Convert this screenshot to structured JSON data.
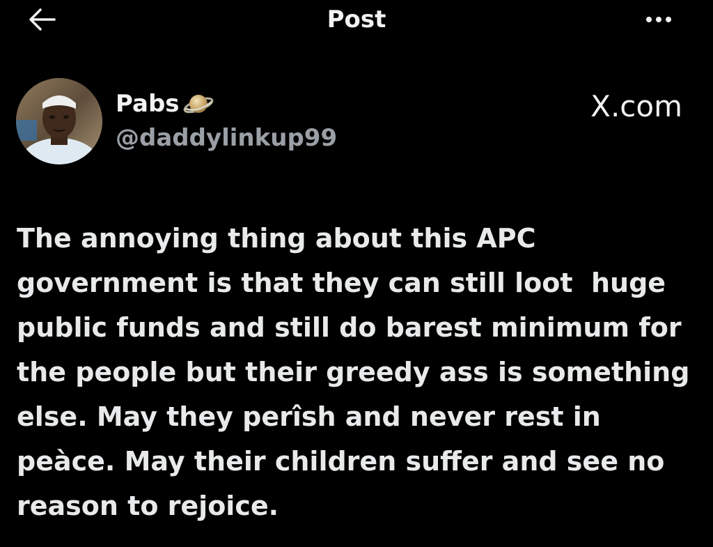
{
  "header": {
    "title": "Post",
    "back_icon": "arrow-left-icon",
    "more_icon": "more-horizontal-icon"
  },
  "post": {
    "author": {
      "display_name": "Pabs",
      "badge_icon": "saturn-planet-icon",
      "handle": "@daddylinkup99"
    },
    "watermark": "X.com",
    "text": "The annoying thing about this APC government is that they can still loot  huge public funds and still do barest minimum for the people but their greedy ass is something else. May they perîsh and never rest in peàce. May their children suffer and see no reason to rejoice."
  },
  "colors": {
    "background": "#000000",
    "text_primary": "#e7e9ea",
    "text_secondary": "#9aa0a6"
  }
}
